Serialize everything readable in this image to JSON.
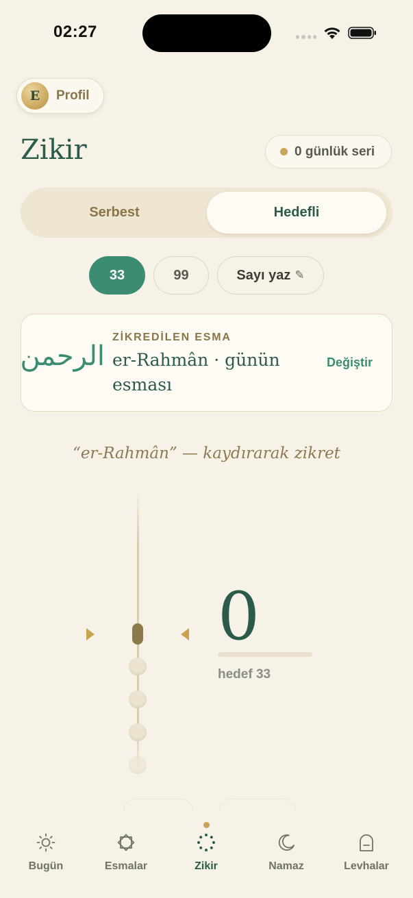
{
  "status_bar": {
    "time": "02:27"
  },
  "header": {
    "profile": {
      "initial": "E",
      "label": "Profil"
    },
    "title": "Zikir",
    "streak": "0 günlük seri"
  },
  "mode_toggle": {
    "options": [
      "Serbest",
      "Hedefli"
    ],
    "selected": "Hedefli"
  },
  "count_options": {
    "items": [
      "33",
      "99",
      "Sayı yaz"
    ],
    "custom_icon": "✎",
    "selected": "33"
  },
  "esma_card": {
    "arabic": "الرحمن",
    "label": "ZİKREDİLEN ESMA",
    "name": "er-Rahmân · günün esması",
    "action": "Değiştir"
  },
  "prompt": "“er-Rahmân” — kaydırarak zikret",
  "counter": {
    "value": "0",
    "target_label": "hedef 33",
    "progress_fraction": 0
  },
  "tab_bar": {
    "items": [
      {
        "label": "Bugün",
        "icon": "sun-icon"
      },
      {
        "label": "Esmalar",
        "icon": "star-octagon-icon"
      },
      {
        "label": "Zikir",
        "icon": "prayer-beads-icon"
      },
      {
        "label": "Namaz",
        "icon": "crescent-moon-icon"
      },
      {
        "label": "Levhalar",
        "icon": "tablet-arch-icon"
      }
    ],
    "active": "Zikir"
  },
  "colors": {
    "background": "#f6f2e8",
    "primary_green": "#2c5b4c",
    "accent_green": "#3c8c74",
    "gold": "#c9a45a",
    "gold_text": "#8a7548"
  }
}
